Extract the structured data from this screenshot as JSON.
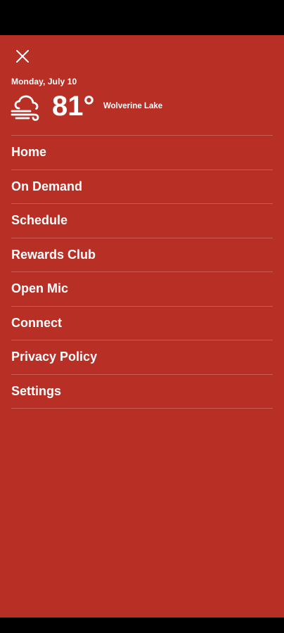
{
  "colors": {
    "drawer_background": "#b72f25",
    "text": "#ffffff",
    "divider": "rgba(255,255,255,0.22)"
  },
  "header": {
    "close_icon": "close-icon",
    "date": "Monday, July 10",
    "weather_icon": "wind-cloud-icon",
    "temperature": "81°",
    "location": "Wolverine Lake"
  },
  "menu": {
    "items": [
      {
        "label": "Home"
      },
      {
        "label": "On Demand"
      },
      {
        "label": "Schedule"
      },
      {
        "label": "Rewards Club"
      },
      {
        "label": "Open Mic"
      },
      {
        "label": "Connect"
      },
      {
        "label": "Privacy Policy"
      },
      {
        "label": "Settings"
      }
    ]
  }
}
